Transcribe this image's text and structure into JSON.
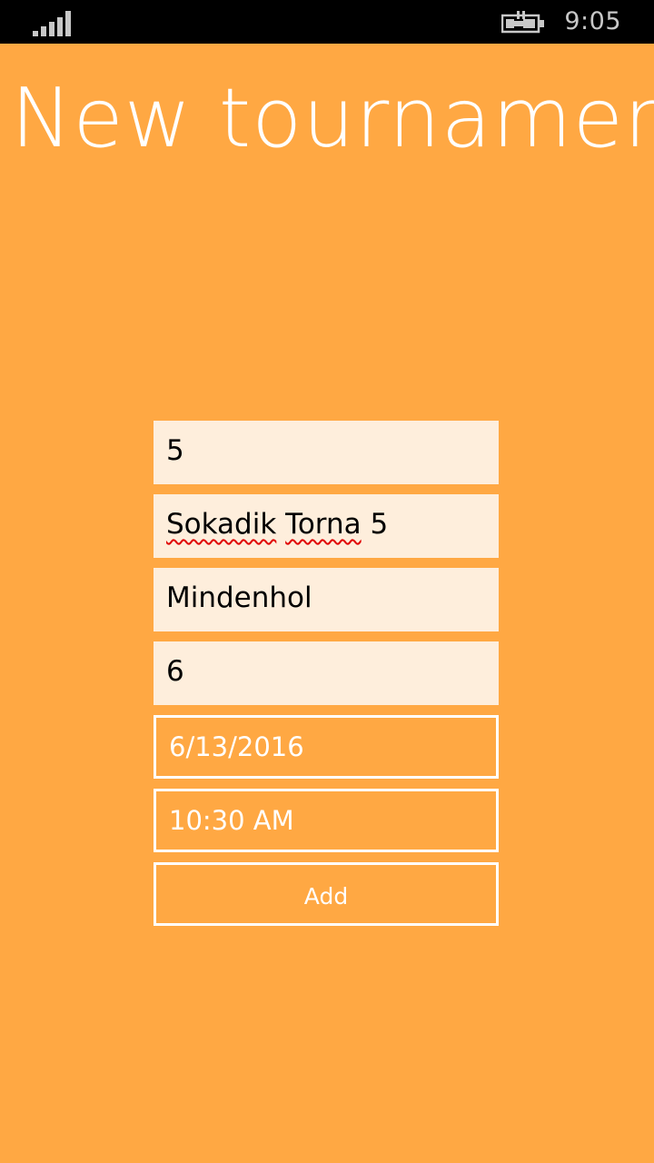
{
  "status_bar": {
    "time": "9:05",
    "signal_icon": "signal-bars-icon",
    "battery_icon": "battery-charging-icon"
  },
  "page": {
    "title": "New tournamen"
  },
  "form": {
    "field_1": "5",
    "field_2_word_1": "Sokadik",
    "field_2_word_2": "Torna",
    "field_2_word_3": "5",
    "field_3": "Mindenhol",
    "field_4": "6",
    "date": "6/13/2016",
    "time": "10:30 AM",
    "add_label": "Add"
  },
  "colors": {
    "background": "#FFA843",
    "field_background": "#FEEEDC",
    "status_bar": "#000000",
    "foreground": "#FFFFFF",
    "spellcheck": "#E00000"
  }
}
